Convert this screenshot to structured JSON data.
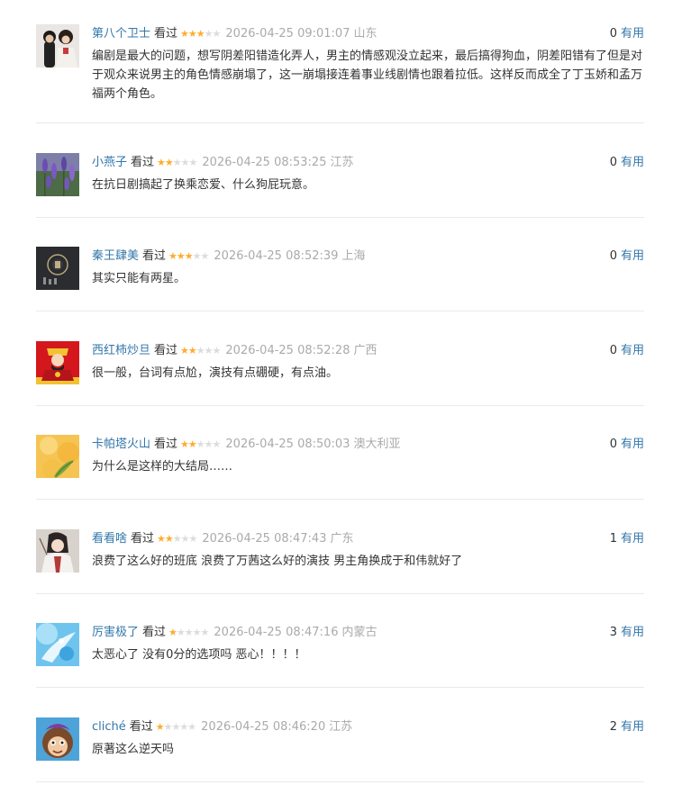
{
  "comments": [
    {
      "user": "第八个卫士",
      "status": "看过",
      "rating": 3,
      "time": "2026-04-25 09:01:07",
      "location": "山东",
      "votes": "0",
      "useful_label": "有用",
      "avatar_icon": "avatar-couple-photo",
      "text": "编剧是最大的问题，想写阴差阳错造化弄人，男主的情感观没立起来，最后搞得狗血，阴差阳错有了但是对于观众来说男主的角色情感崩塌了，这一崩塌接连着事业线剧情也跟着拉低。这样反而成全了丁玉娇和孟万福两个角色。"
    },
    {
      "user": "小燕子",
      "status": "看过",
      "rating": 2,
      "time": "2026-04-25 08:53:25",
      "location": "江苏",
      "votes": "0",
      "useful_label": "有用",
      "avatar_icon": "avatar-lavender",
      "text": "在抗日剧搞起了换乘恋爱、什么狗屁玩意。"
    },
    {
      "user": "秦王肆美",
      "status": "看过",
      "rating": 3,
      "time": "2026-04-25 08:52:39",
      "location": "上海",
      "votes": "0",
      "useful_label": "有用",
      "avatar_icon": "avatar-dark-emblem",
      "text": "其实只能有两星。"
    },
    {
      "user": "西红柿炒旦",
      "status": "看过",
      "rating": 2,
      "time": "2026-04-25 08:52:28",
      "location": "广西",
      "votes": "0",
      "useful_label": "有用",
      "avatar_icon": "avatar-red-deity",
      "text": "很一般，台词有点尬，演技有点硼硬，有点油。"
    },
    {
      "user": "卡帕塔火山",
      "status": "看过",
      "rating": 2,
      "time": "2026-04-25 08:50:03",
      "location": "澳大利亚",
      "votes": "0",
      "useful_label": "有用",
      "avatar_icon": "avatar-orange-fruit",
      "text": "为什么是这样的大结局……"
    },
    {
      "user": "看看啥",
      "status": "看过",
      "rating": 2,
      "time": "2026-04-25 08:47:43",
      "location": "广东",
      "votes": "1",
      "useful_label": "有用",
      "avatar_icon": "avatar-painted-figure",
      "text": "浪费了这么好的班底 浪费了万茜这么好的演技 男主角换成于和伟就好了"
    },
    {
      "user": "厉害极了",
      "status": "看过",
      "rating": 1,
      "time": "2026-04-25 08:47:16",
      "location": "内蒙古",
      "votes": "3",
      "useful_label": "有用",
      "avatar_icon": "avatar-blue-splash",
      "text": "太恶心了 没有0分的选项吗 恶心！！！！"
    },
    {
      "user": "cliché",
      "status": "看过",
      "rating": 1,
      "time": "2026-04-25 08:46:20",
      "location": "江苏",
      "votes": "2",
      "useful_label": "有用",
      "avatar_icon": "avatar-cartoon-monkey",
      "text": "原著这么逆天吗"
    }
  ]
}
